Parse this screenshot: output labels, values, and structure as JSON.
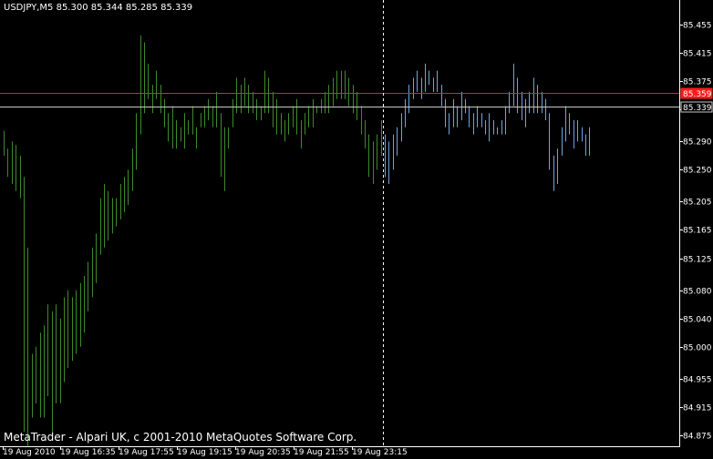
{
  "header": {
    "symbol_line": "USDJPY,M5  85.300 85.344 85.285 85.339"
  },
  "footer": {
    "copyright": "MetaTrader - Alpari UK, c 2001-2010 MetaQuotes Software Corp."
  },
  "colors": {
    "background": "#000000",
    "text": "#ffffff",
    "bar_history": "#3d8a2c",
    "bar_recent": "#6fa3e0",
    "ask_line": "#ff1a1a",
    "bid_line": "#c8c8c8",
    "axis": "#ffffff",
    "cursor_line": "#ffffff"
  },
  "chart_data": {
    "type": "bar",
    "title": "USDJPY,M5",
    "ohlc_header": [
      "85.300",
      "85.344",
      "85.285",
      "85.339"
    ],
    "ylim": [
      84.862,
      85.477
    ],
    "y_ticks": [
      "85.455",
      "85.415",
      "85.375",
      "85.335",
      "85.290",
      "85.250",
      "85.205",
      "85.165",
      "85.125",
      "85.080",
      "85.040",
      "85.000",
      "84.955",
      "84.915",
      "84.875"
    ],
    "x_ticks": [
      "19 Aug 2010",
      "19 Aug 16:35",
      "19 Aug 17:55",
      "19 Aug 19:15",
      "19 Aug 20:35",
      "19 Aug 21:55",
      "19 Aug 23:15"
    ],
    "ask_line": {
      "value": 85.359,
      "label": "85.359"
    },
    "bid_line": {
      "value": 85.339,
      "label": "85.339"
    },
    "series": [
      {
        "values": [
          {
            "h": 85.305,
            "l": 85.27
          },
          {
            "h": 85.28,
            "l": 85.24
          },
          {
            "h": 85.29,
            "l": 85.23
          },
          {
            "h": 85.285,
            "l": 85.22
          },
          {
            "h": 85.27,
            "l": 85.21
          },
          {
            "h": 85.24,
            "l": 84.88
          },
          {
            "h": 85.14,
            "l": 84.86
          },
          {
            "h": 84.99,
            "l": 84.9
          },
          {
            "h": 85.0,
            "l": 84.92
          },
          {
            "h": 85.02,
            "l": 84.9
          },
          {
            "h": 85.03,
            "l": 84.9
          },
          {
            "h": 85.06,
            "l": 84.93
          },
          {
            "h": 85.05,
            "l": 84.88
          },
          {
            "h": 85.06,
            "l": 84.92
          },
          {
            "h": 85.04,
            "l": 84.92
          },
          {
            "h": 85.07,
            "l": 84.95
          },
          {
            "h": 85.08,
            "l": 84.97
          },
          {
            "h": 85.07,
            "l": 84.98
          },
          {
            "h": 85.08,
            "l": 84.99
          },
          {
            "h": 85.09,
            "l": 85.0
          },
          {
            "h": 85.1,
            "l": 85.02
          },
          {
            "h": 85.12,
            "l": 85.05
          },
          {
            "h": 85.14,
            "l": 85.07
          },
          {
            "h": 85.16,
            "l": 85.09
          },
          {
            "h": 85.21,
            "l": 85.13
          },
          {
            "h": 85.23,
            "l": 85.14
          },
          {
            "h": 85.22,
            "l": 85.15
          },
          {
            "h": 85.21,
            "l": 85.16
          },
          {
            "h": 85.21,
            "l": 85.17
          },
          {
            "h": 85.23,
            "l": 85.18
          },
          {
            "h": 85.24,
            "l": 85.19
          },
          {
            "h": 85.25,
            "l": 85.2
          },
          {
            "h": 85.28,
            "l": 85.22
          },
          {
            "h": 85.33,
            "l": 85.25
          },
          {
            "h": 85.44,
            "l": 85.3
          },
          {
            "h": 85.43,
            "l": 85.33
          },
          {
            "h": 85.4,
            "l": 85.35
          },
          {
            "h": 85.37,
            "l": 85.33
          },
          {
            "h": 85.39,
            "l": 85.35
          },
          {
            "h": 85.37,
            "l": 85.33
          },
          {
            "h": 85.35,
            "l": 85.31
          },
          {
            "h": 85.33,
            "l": 85.29
          },
          {
            "h": 85.34,
            "l": 85.28
          },
          {
            "h": 85.32,
            "l": 85.28
          },
          {
            "h": 85.31,
            "l": 85.29
          },
          {
            "h": 85.33,
            "l": 85.28
          },
          {
            "h": 85.32,
            "l": 85.3
          },
          {
            "h": 85.34,
            "l": 85.3
          },
          {
            "h": 85.31,
            "l": 85.28
          },
          {
            "h": 85.33,
            "l": 85.31
          },
          {
            "h": 85.34,
            "l": 85.31
          },
          {
            "h": 85.35,
            "l": 85.32
          },
          {
            "h": 85.34,
            "l": 85.31
          },
          {
            "h": 85.36,
            "l": 85.31
          },
          {
            "h": 85.33,
            "l": 85.24
          },
          {
            "h": 85.31,
            "l": 85.22
          },
          {
            "h": 85.31,
            "l": 85.28
          },
          {
            "h": 85.35,
            "l": 85.31
          },
          {
            "h": 85.38,
            "l": 85.33
          },
          {
            "h": 85.37,
            "l": 85.33
          },
          {
            "h": 85.38,
            "l": 85.34
          },
          {
            "h": 85.37,
            "l": 85.33
          },
          {
            "h": 85.36,
            "l": 85.33
          },
          {
            "h": 85.35,
            "l": 85.32
          },
          {
            "h": 85.34,
            "l": 85.32
          },
          {
            "h": 85.39,
            "l": 85.33
          },
          {
            "h": 85.38,
            "l": 85.33
          },
          {
            "h": 85.36,
            "l": 85.31
          },
          {
            "h": 85.35,
            "l": 85.3
          },
          {
            "h": 85.33,
            "l": 85.3
          },
          {
            "h": 85.32,
            "l": 85.29
          },
          {
            "h": 85.33,
            "l": 85.3
          },
          {
            "h": 85.34,
            "l": 85.31
          },
          {
            "h": 85.35,
            "l": 85.3
          },
          {
            "h": 85.32,
            "l": 85.28
          },
          {
            "h": 85.33,
            "l": 85.3
          },
          {
            "h": 85.34,
            "l": 85.31
          },
          {
            "h": 85.35,
            "l": 85.31
          },
          {
            "h": 85.34,
            "l": 85.33
          },
          {
            "h": 85.35,
            "l": 85.33
          },
          {
            "h": 85.36,
            "l": 85.33
          },
          {
            "h": 85.37,
            "l": 85.33
          },
          {
            "h": 85.38,
            "l": 85.34
          },
          {
            "h": 85.39,
            "l": 85.35
          },
          {
            "h": 85.39,
            "l": 85.35
          },
          {
            "h": 85.39,
            "l": 85.35
          },
          {
            "h": 85.38,
            "l": 85.34
          },
          {
            "h": 85.37,
            "l": 85.33
          },
          {
            "h": 85.36,
            "l": 85.32
          },
          {
            "h": 85.34,
            "l": 85.3
          },
          {
            "h": 85.32,
            "l": 85.28
          },
          {
            "h": 85.3,
            "l": 85.24
          },
          {
            "h": 85.29,
            "l": 85.23
          },
          {
            "h": 85.3,
            "l": 85.25
          },
          {
            "h": 85.32,
            "l": 85.27
          }
        ]
      },
      {
        "values": [
          {
            "h": 85.3,
            "l": 85.24
          },
          {
            "h": 85.29,
            "l": 85.23
          },
          {
            "h": 85.3,
            "l": 85.25
          },
          {
            "h": 85.31,
            "l": 85.27
          },
          {
            "h": 85.33,
            "l": 85.29
          },
          {
            "h": 85.35,
            "l": 85.31
          },
          {
            "h": 85.37,
            "l": 85.33
          },
          {
            "h": 85.38,
            "l": 85.35
          },
          {
            "h": 85.39,
            "l": 85.36
          },
          {
            "h": 85.38,
            "l": 85.35
          },
          {
            "h": 85.4,
            "l": 85.36
          },
          {
            "h": 85.39,
            "l": 85.37
          },
          {
            "h": 85.38,
            "l": 85.36
          },
          {
            "h": 85.39,
            "l": 85.36
          },
          {
            "h": 85.37,
            "l": 85.34
          },
          {
            "h": 85.35,
            "l": 85.31
          },
          {
            "h": 85.33,
            "l": 85.3
          },
          {
            "h": 85.35,
            "l": 85.31
          },
          {
            "h": 85.34,
            "l": 85.31
          },
          {
            "h": 85.36,
            "l": 85.32
          },
          {
            "h": 85.35,
            "l": 85.33
          },
          {
            "h": 85.34,
            "l": 85.31
          },
          {
            "h": 85.33,
            "l": 85.3
          },
          {
            "h": 85.34,
            "l": 85.31
          },
          {
            "h": 85.33,
            "l": 85.31
          },
          {
            "h": 85.32,
            "l": 85.3
          },
          {
            "h": 85.33,
            "l": 85.29
          },
          {
            "h": 85.32,
            "l": 85.3
          },
          {
            "h": 85.31,
            "l": 85.3
          },
          {
            "h": 85.32,
            "l": 85.3
          },
          {
            "h": 85.34,
            "l": 85.3
          },
          {
            "h": 85.36,
            "l": 85.33
          },
          {
            "h": 85.4,
            "l": 85.34
          },
          {
            "h": 85.38,
            "l": 85.33
          },
          {
            "h": 85.36,
            "l": 85.32
          },
          {
            "h": 85.35,
            "l": 85.31
          },
          {
            "h": 85.36,
            "l": 85.33
          },
          {
            "h": 85.38,
            "l": 85.33
          },
          {
            "h": 85.37,
            "l": 85.33
          },
          {
            "h": 85.36,
            "l": 85.33
          },
          {
            "h": 85.35,
            "l": 85.32
          },
          {
            "h": 85.33,
            "l": 85.25
          },
          {
            "h": 85.27,
            "l": 85.22
          },
          {
            "h": 85.28,
            "l": 85.23
          },
          {
            "h": 85.31,
            "l": 85.27
          },
          {
            "h": 85.34,
            "l": 85.29
          },
          {
            "h": 85.33,
            "l": 85.3
          },
          {
            "h": 85.32,
            "l": 85.28
          },
          {
            "h": 85.32,
            "l": 85.29
          },
          {
            "h": 85.31,
            "l": 85.29
          },
          {
            "h": 85.3,
            "l": 85.27
          },
          {
            "h": 85.31,
            "l": 85.27
          }
        ]
      }
    ]
  }
}
